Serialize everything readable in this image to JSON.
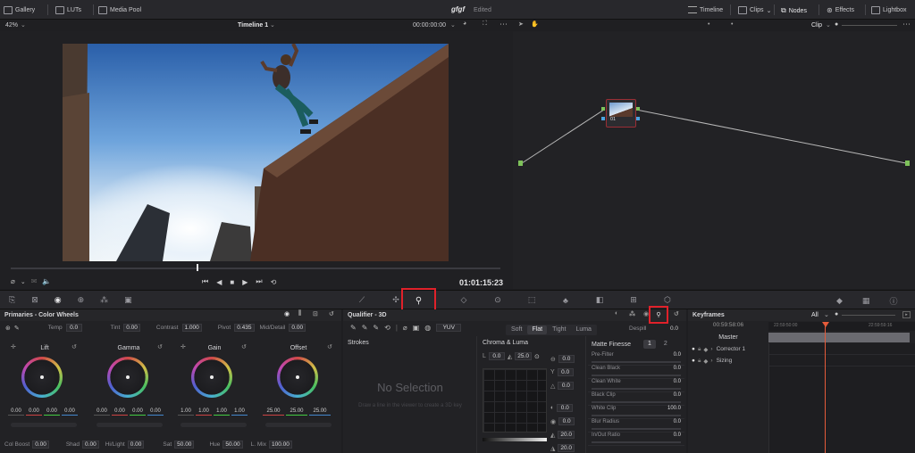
{
  "topbar": {
    "gallery": "Gallery",
    "luts": "LUTs",
    "media_pool": "Media Pool",
    "project": "gfgf",
    "status": "Edited",
    "timeline": "Timeline",
    "clips": "Clips",
    "nodes": "Nodes",
    "effects": "Effects",
    "lightbox": "Lightbox"
  },
  "viewer": {
    "zoom": "42%",
    "timeline_name": "Timeline 1",
    "source_tc": "00:00:00:00",
    "timecode": "01:01:15:23"
  },
  "nodegraph": {
    "mode": "Clip",
    "node_label": "01"
  },
  "primaries": {
    "title": "Primaries - Color Wheels",
    "temp_label": "Temp",
    "temp": "0.0",
    "tint_label": "Tint",
    "tint": "0.00",
    "contrast_label": "Contrast",
    "contrast": "1.000",
    "pivot_label": "Pivot",
    "pivot": "0.435",
    "middetail_label": "Mid/Detail",
    "middetail": "0.00",
    "wheels": [
      {
        "name": "Lift",
        "vals": [
          "0.00",
          "0.00",
          "0.00",
          "0.00"
        ]
      },
      {
        "name": "Gamma",
        "vals": [
          "0.00",
          "0.00",
          "0.00",
          "0.00"
        ]
      },
      {
        "name": "Gain",
        "vals": [
          "1.00",
          "1.00",
          "1.00",
          "1.00"
        ]
      },
      {
        "name": "Offset",
        "vals": [
          "25.00",
          "25.00",
          "25.00"
        ]
      }
    ],
    "colboost_label": "Col Boost",
    "colboost": "0.00",
    "shad_label": "Shad",
    "shad": "0.00",
    "hilight_label": "Hi/Light",
    "hilight": "0.00",
    "sat_label": "Sat",
    "sat": "50.00",
    "hue_label": "Hue",
    "hue": "50.00",
    "lmix_label": "L. Mix",
    "lmix": "100.00"
  },
  "qualifier": {
    "title": "Qualifier - 3D",
    "yuv": "YUV",
    "tabs": [
      "Soft",
      "Flat",
      "Tight",
      "Luma"
    ],
    "despill_label": "Despill",
    "despill": "0.0",
    "strokes": "Strokes",
    "empty_title": "No Selection",
    "empty_hint": "Draw a line in the viewer to create a 3D key",
    "chroma_title": "Chroma & Luma",
    "chroma_val1": "0.0",
    "chroma_val2": "25.0",
    "side_vals": [
      "0.0",
      "0.0",
      "0.0",
      "0.0",
      "0.0",
      "20.0",
      "20.0"
    ],
    "mf_title": "Matte Finesse",
    "mf_tab1": "1",
    "mf_tab2": "2",
    "mf": [
      [
        "Pre-Filter",
        "0.0"
      ],
      [
        "Clean Black",
        "0.0"
      ],
      [
        "Clean White",
        "0.0"
      ],
      [
        "Black Clip",
        "0.0"
      ],
      [
        "White Clip",
        "100.0"
      ],
      [
        "Blur Radius",
        "0.0"
      ],
      [
        "In/Out Ratio",
        "0.0"
      ]
    ]
  },
  "keyframes": {
    "title": "Keyframes",
    "filter": "All",
    "timecode": "00:59:58:06",
    "ruler_left": "22:59:50:00",
    "ruler_right": "22:59:59:16",
    "master": "Master",
    "tracks": [
      "Corrector 1",
      "Sizing"
    ]
  },
  "colors": {
    "accent_red": "#e0212a",
    "playhead": "#e55b3a",
    "node_line": "#b8b8b8"
  }
}
